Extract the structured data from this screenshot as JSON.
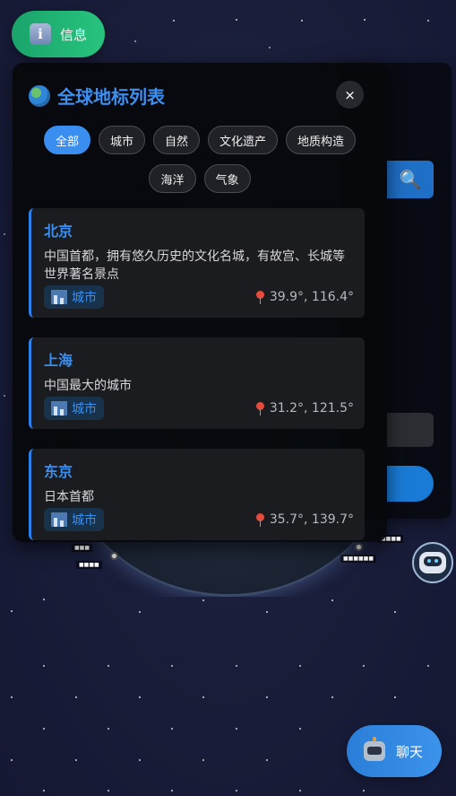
{
  "info_button": {
    "label": "信息",
    "icon": "info-icon"
  },
  "panel": {
    "title": "全球地标列表",
    "title_icon": "earth-globe-icon",
    "close_label": "×"
  },
  "filters": [
    "全部",
    "城市",
    "自然",
    "文化遗产",
    "地质构造",
    "海洋",
    "气象"
  ],
  "active_filter": "全部",
  "landmarks": [
    {
      "name": "北京",
      "description": "中国首都，拥有悠久历史的文化名城，有故宫、长城等世界著名景点",
      "category": "城市",
      "coords": "39.9°, 116.4°"
    },
    {
      "name": "上海",
      "description": "中国最大的城市",
      "category": "城市",
      "coords": "31.2°, 121.5°"
    },
    {
      "name": "东京",
      "description": "日本首都",
      "category": "城市",
      "coords": "35.7°, 139.7°"
    }
  ],
  "chat_button": {
    "label": "聊天",
    "icon": "robot-icon"
  },
  "colors": {
    "accent": "#3a8ef0",
    "info_green": "#1fb373",
    "panel_bg": "#06080c",
    "card_bg": "#1b1c20",
    "space_bg": "#1a1e3a"
  }
}
